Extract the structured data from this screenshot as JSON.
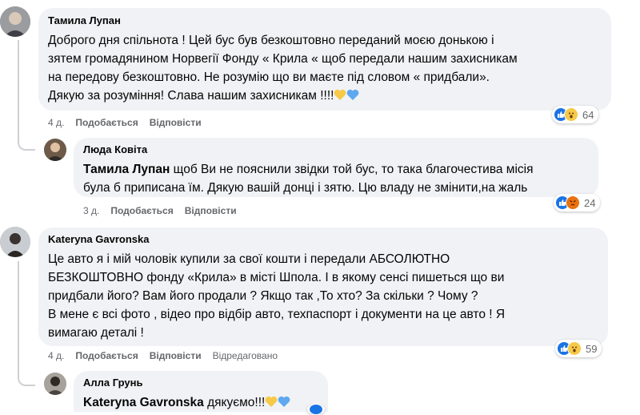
{
  "comments": [
    {
      "author": "Тамила Лупан",
      "lines": [
        "Доброго дня спільнота ! Цей бус був безкоштовно переданий моєю донькою і",
        "зятем громадянином Норвегії Фонду « Крила « щоб передали нашим захисникам",
        "на передову безкоштовно. Не розумію що ви маєте під словом « придбали».",
        "Дякую за розуміння! Слава нашим захисникам !!!!"
      ],
      "time": "4 д.",
      "like": "Подобається",
      "reply": "Відповісти",
      "reaction_count": "64"
    },
    {
      "author": "Люда Ковіта",
      "mention": "Тамила Лупан",
      "lines": [
        " щоб Ви не пояснили звідки той бус, то така благочестива місія",
        "була б приписана їм. Дякую вашій донці і зятю. Цю владу не змінити,на жаль"
      ],
      "time": "3 д.",
      "like": "Подобається",
      "reply": "Відповісти",
      "reaction_count": "24"
    },
    {
      "author": "Kateryna Gavronska",
      "lines": [
        "Це авто я і мій чоловік купили за свої кошти і передали АБСОЛЮТНО",
        "БЕЗКОШТОВНО фонду «Крила» в місті Шпола. І в якому сенсі пишеться що ви",
        "придбали його? Вам його продали ? Якщо так ,То хто? За скільки ? Чому ?",
        "В мене є всі фото , відео про відбір авто, техпаспорт і документи на це авто ! Я",
        "вимагаю деталі !"
      ],
      "time": "4 д.",
      "like": "Подобається",
      "reply": "Відповісти",
      "edited": "Відредаговано",
      "reaction_count": "59"
    },
    {
      "author": "Алла Грунь",
      "mention": "Kateryna Gavronska",
      "text": " дякуємо!!!"
    }
  ],
  "colors": {
    "bubble": "#f0f2f5",
    "meta": "#65676b",
    "like_blue": "#1b74e4",
    "wow_yellow": "#f7c947",
    "angry_orange": "#e9710f"
  }
}
